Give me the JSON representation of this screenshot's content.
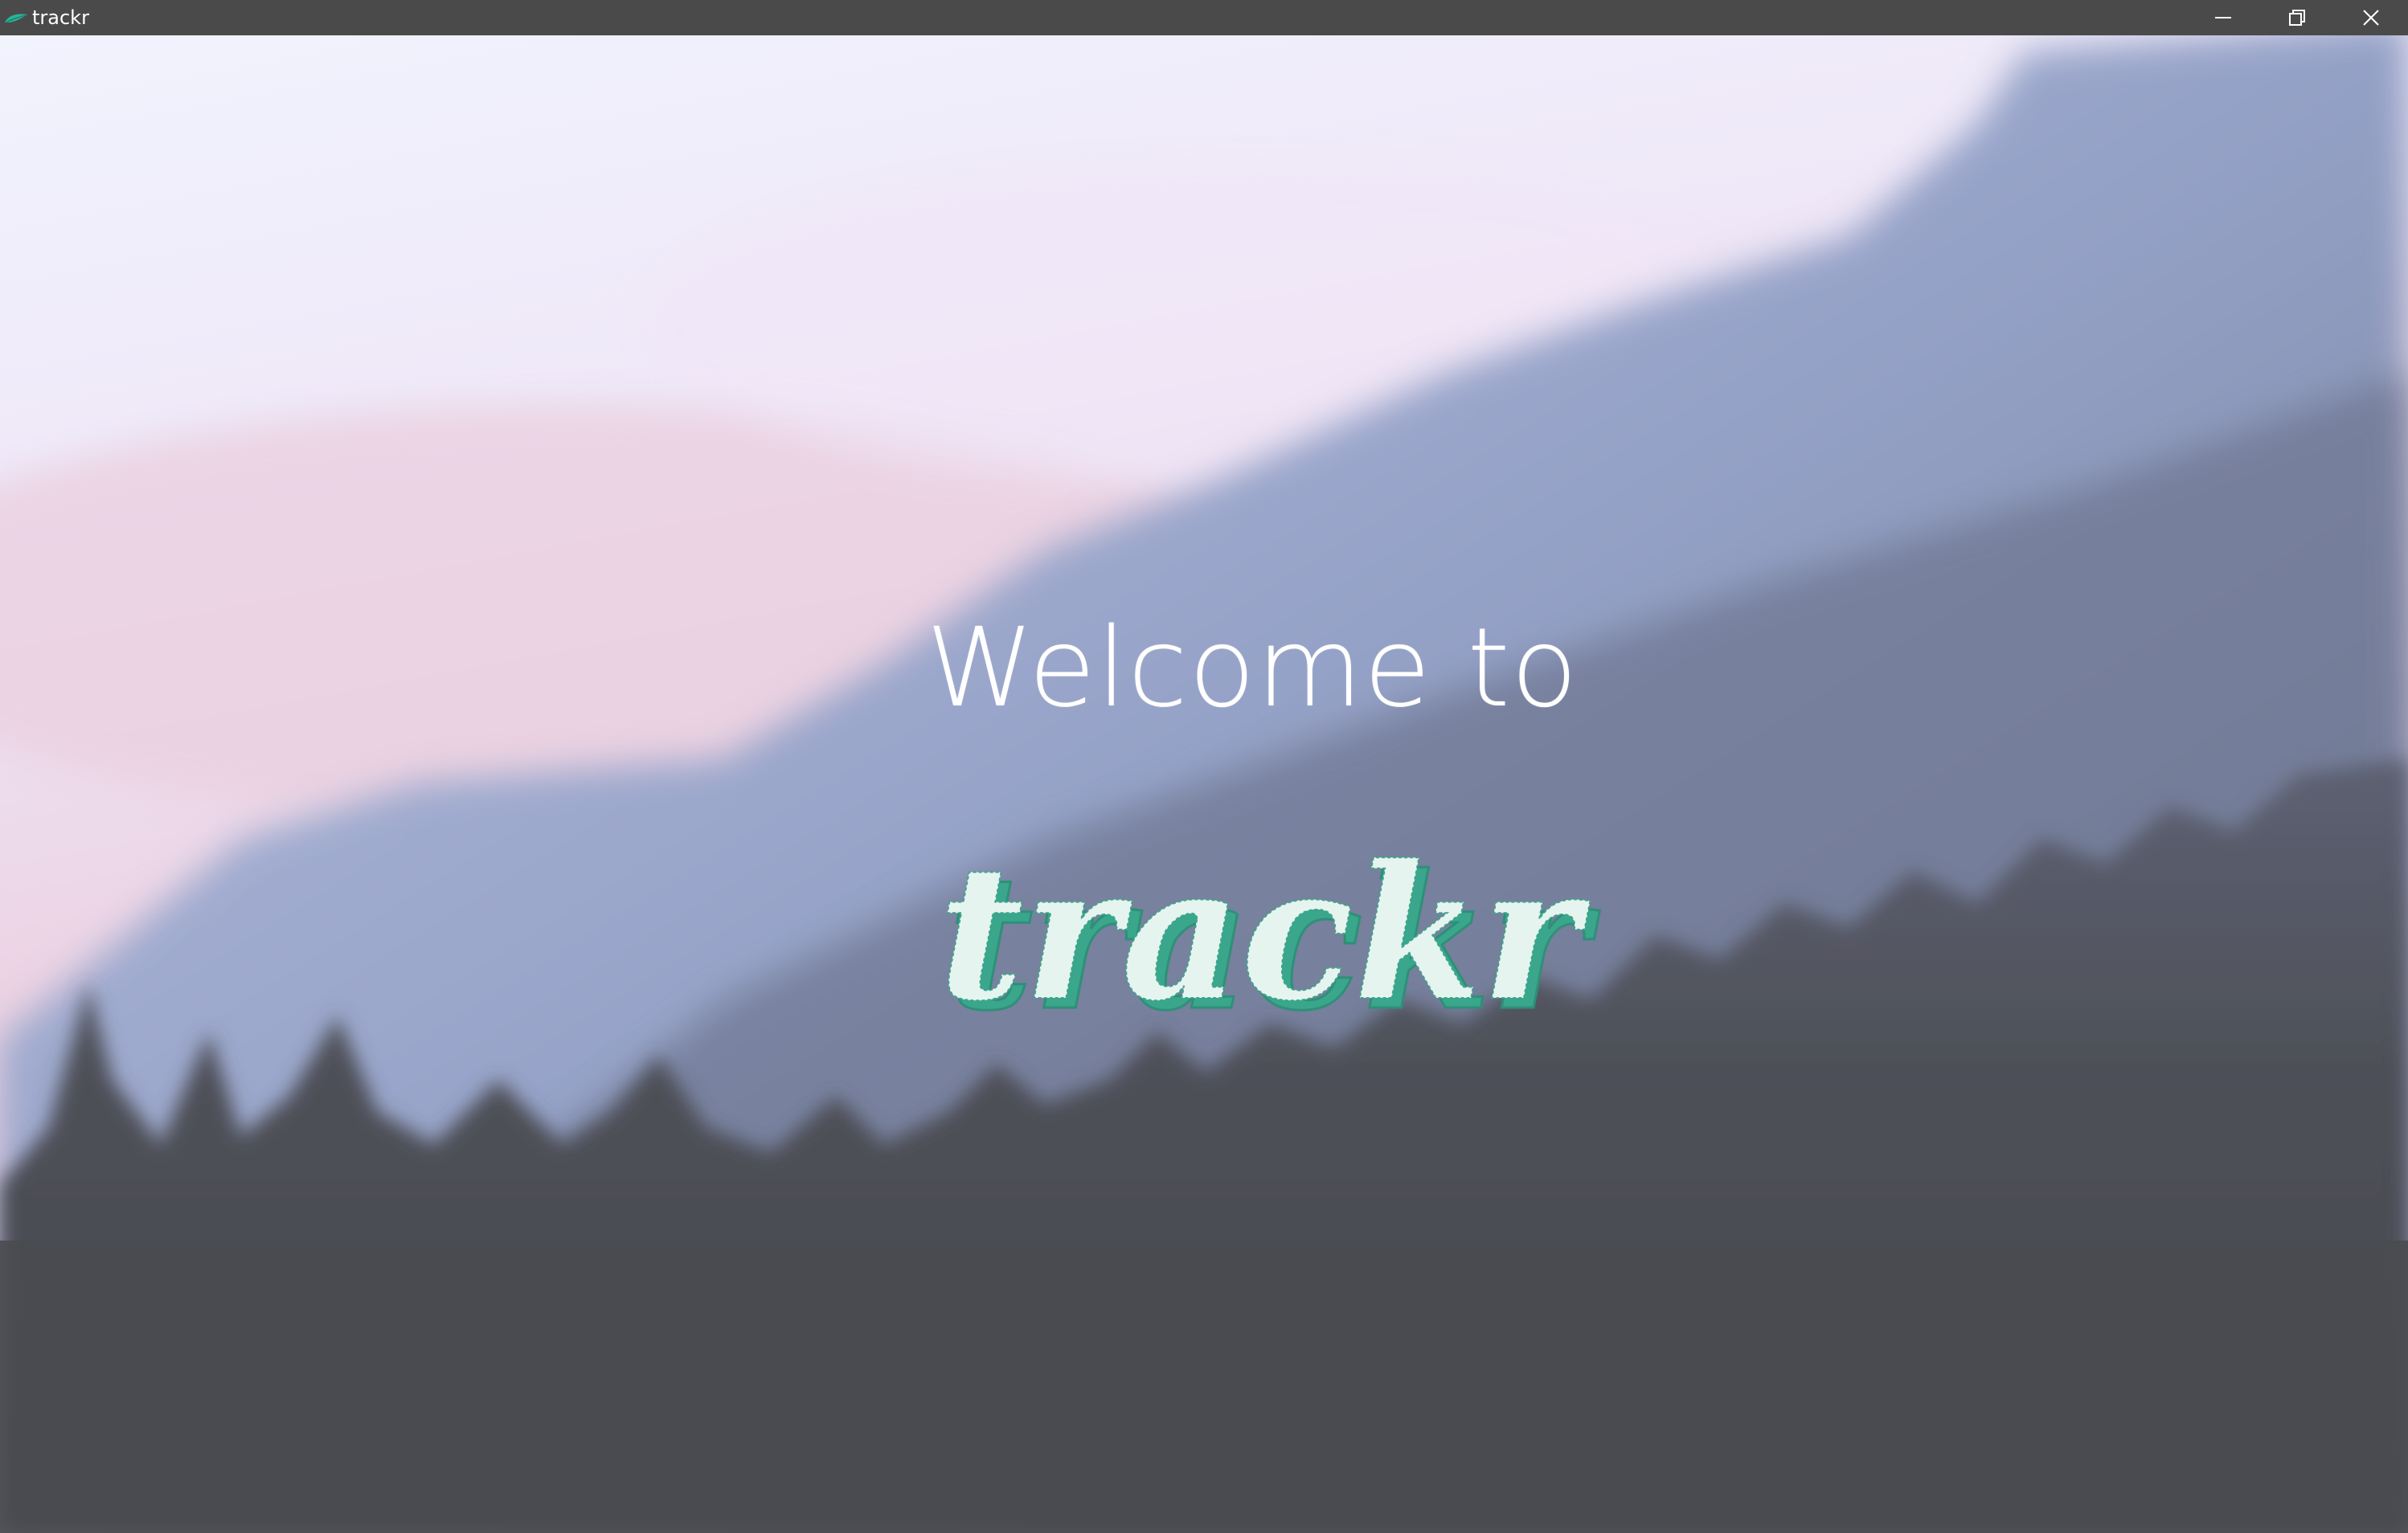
{
  "window": {
    "title": "trackr",
    "app_icon": "trackr-leaf-icon",
    "controls": {
      "minimize_icon": "minimize-icon",
      "maximize_icon": "restore-icon",
      "close_icon": "close-icon"
    }
  },
  "main": {
    "welcome_text": "Welcome to",
    "logo_text": "trackr",
    "logo_icon": "trackr-logo"
  },
  "colors": {
    "titlebar": "#4a4a4a",
    "logo_fill": "#e6f4ef",
    "logo_shadow": "#3aa68b",
    "sky_top": "#f1effd",
    "sky_pink": "#ecd3e2",
    "mountain": "#8e9dc3",
    "forest": "#4b4c52"
  }
}
